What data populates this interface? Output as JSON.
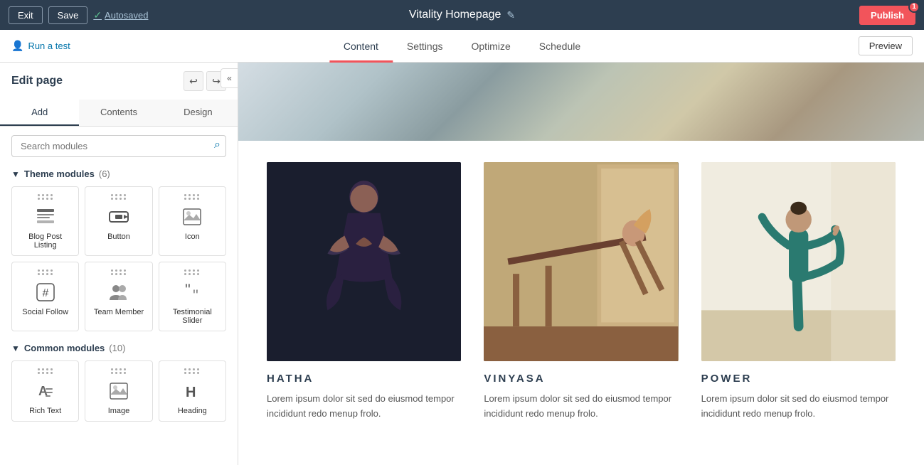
{
  "topbar": {
    "exit_label": "Exit",
    "save_label": "Save",
    "autosaved_label": "Autosaved",
    "page_title": "Vitality Homepage",
    "publish_label": "Publish",
    "publish_badge": "1",
    "edit_icon": "✎"
  },
  "secondbar": {
    "run_test_label": "Run a test",
    "tabs": [
      {
        "id": "content",
        "label": "Content",
        "active": true
      },
      {
        "id": "settings",
        "label": "Settings",
        "active": false
      },
      {
        "id": "optimize",
        "label": "Optimize",
        "active": false
      },
      {
        "id": "schedule",
        "label": "Schedule",
        "active": false
      }
    ],
    "preview_label": "Preview"
  },
  "sidebar": {
    "edit_page_title": "Edit page",
    "panel_tabs": [
      {
        "id": "add",
        "label": "Add",
        "active": true
      },
      {
        "id": "contents",
        "label": "Contents",
        "active": false
      },
      {
        "id": "design",
        "label": "Design",
        "active": false
      }
    ],
    "search_placeholder": "Search modules",
    "theme_section_label": "Theme modules",
    "theme_count": "(6)",
    "theme_modules": [
      {
        "id": "blog-post-listing",
        "label": "Blog Post Listing",
        "icon": "list"
      },
      {
        "id": "button",
        "label": "Button",
        "icon": "button"
      },
      {
        "id": "icon",
        "label": "Icon",
        "icon": "image"
      },
      {
        "id": "social-follow",
        "label": "Social Follow",
        "icon": "hash"
      },
      {
        "id": "team-member",
        "label": "Team Member",
        "icon": "team"
      },
      {
        "id": "testimonial-slider",
        "label": "Testimonial Slider",
        "icon": "quote"
      }
    ],
    "common_section_label": "Common modules",
    "common_count": "(10)",
    "common_modules": [
      {
        "id": "rich-text",
        "label": "Rich Text",
        "icon": "text"
      },
      {
        "id": "image-mod",
        "label": "Image",
        "icon": "img"
      },
      {
        "id": "heading",
        "label": "Heading",
        "icon": "heading"
      }
    ]
  },
  "canvas": {
    "cards": [
      {
        "id": "hatha",
        "title": "HATHA",
        "text": "Lorem ipsum dolor sit sed do eiusmod tempor incididunt redo menup frolo.",
        "img_class": "img-hatha"
      },
      {
        "id": "vinyasa",
        "title": "VINYASA",
        "text": "Lorem ipsum dolor sit sed do eiusmod tempor incididunt redo menup frolo.",
        "img_class": "img-vinyasa"
      },
      {
        "id": "power",
        "title": "POWER",
        "text": "Lorem ipsum dolor sit sed do eiusmod tempor incididunt redo menup frolo.",
        "img_class": "img-power"
      }
    ]
  }
}
